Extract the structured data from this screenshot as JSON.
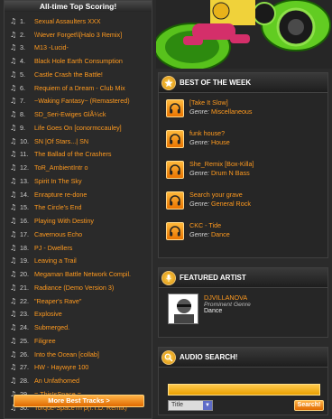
{
  "left": {
    "title": "All-time Top Scoring!",
    "tracks": [
      {
        "num": "1.",
        "title": "Sexual Assaulters XXX"
      },
      {
        "num": "2.",
        "title": "\\\\Never Forget\\\\[Halo 3 Remix]"
      },
      {
        "num": "3.",
        "title": "M13 -Lucid-"
      },
      {
        "num": "4.",
        "title": "Black Hole Earth Consumption"
      },
      {
        "num": "5.",
        "title": "Castle Crash the Battle!"
      },
      {
        "num": "6.",
        "title": "Requiem of a Dream - Club Mix"
      },
      {
        "num": "7.",
        "title": "~Waking Fantasy~ (Remastered)"
      },
      {
        "num": "8.",
        "title": "SD_Seri-Ewiges GlÃ¼ck"
      },
      {
        "num": "9.",
        "title": "Life Goes On [conormccauley]"
      },
      {
        "num": "10.",
        "title": "SN |Of Stars...| SN"
      },
      {
        "num": "11.",
        "title": "The Ballad of the Crashers"
      },
      {
        "num": "12.",
        "title": "ToR_AmbientIntr o"
      },
      {
        "num": "13.",
        "title": "Spirit In The Sky"
      },
      {
        "num": "14.",
        "title": "Enrapture re-done"
      },
      {
        "num": "15.",
        "title": "The Circle's End"
      },
      {
        "num": "16.",
        "title": "Playing With Destiny"
      },
      {
        "num": "17.",
        "title": "Cavernous Echo"
      },
      {
        "num": "18.",
        "title": "PJ - Dwellers"
      },
      {
        "num": "19.",
        "title": "Leaving a Trail"
      },
      {
        "num": "20.",
        "title": "Megaman Battle Network Compil."
      },
      {
        "num": "21.",
        "title": "Radiance (Demo Version 3)"
      },
      {
        "num": "22.",
        "title": "\"Reaper's Rave\""
      },
      {
        "num": "23.",
        "title": "Explosive"
      },
      {
        "num": "24.",
        "title": "Submerged."
      },
      {
        "num": "25.",
        "title": "Filigree"
      },
      {
        "num": "26.",
        "title": "Into the Ocean [collab]"
      },
      {
        "num": "27.",
        "title": "HW - Haywyre 100"
      },
      {
        "num": "28.",
        "title": "An Unfathomed"
      },
      {
        "num": "29.",
        "title": "=.ThisIsSpace.="
      },
      {
        "num": "30.",
        "title": "Torque-SpaceTri p(I.T.D. Remix)"
      }
    ],
    "more_button": "More Best Tracks >"
  },
  "best_of_week": {
    "title": "BEST OF THE WEEK",
    "genre_label": "Genre:",
    "items": [
      {
        "title": "[Take It Slow]",
        "genre": "Miscellaneous"
      },
      {
        "title": "funk house?",
        "genre": "House"
      },
      {
        "title": "She_Remix [Box-Killa]",
        "genre": "Drum N Bass"
      },
      {
        "title": "Search your grave",
        "genre": "General Rock"
      },
      {
        "title": "CKC - Tide",
        "genre": "Dance"
      }
    ]
  },
  "featured": {
    "title": "FEATURED ARTIST",
    "name": "DJVILLANOVA",
    "prominent_label": "Prominent Genre",
    "genre": "Dance"
  },
  "search": {
    "title": "AUDIO SEARCH!",
    "query": "",
    "select_value": "Title",
    "button": "Search!"
  },
  "colors": {
    "accent": "#ff9a1f",
    "background": "#2b2b2b"
  }
}
